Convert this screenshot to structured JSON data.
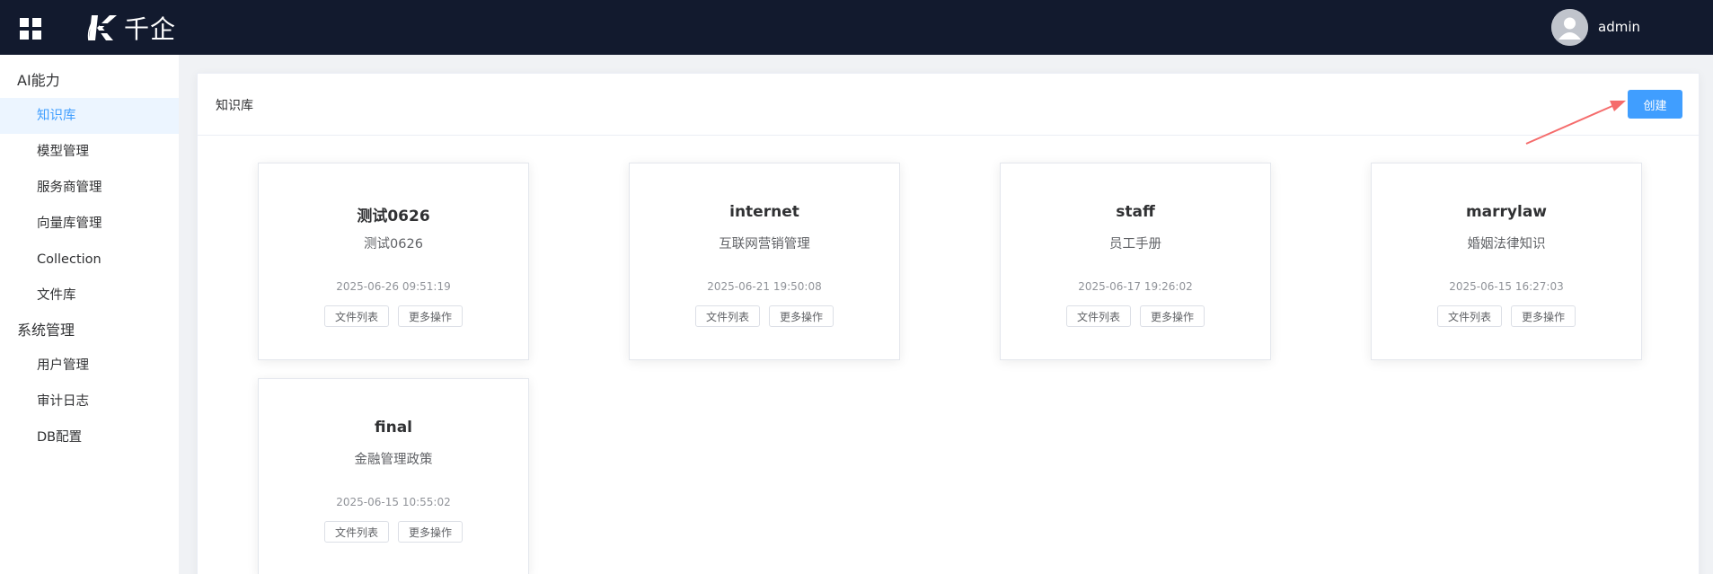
{
  "header": {
    "logo_text": "千企",
    "username": "admin"
  },
  "sidebar": {
    "groups": [
      {
        "label": "AI能力",
        "items": [
          {
            "label": "知识库",
            "active": true
          },
          {
            "label": "模型管理"
          },
          {
            "label": "服务商管理"
          },
          {
            "label": "向量库管理"
          },
          {
            "label": "Collection"
          },
          {
            "label": "文件库"
          }
        ]
      },
      {
        "label": "系统管理",
        "items": [
          {
            "label": "用户管理"
          },
          {
            "label": "审计日志"
          },
          {
            "label": "DB配置"
          }
        ]
      }
    ]
  },
  "main": {
    "title": "知识库",
    "create_label": "创建",
    "file_list_label": "文件列表",
    "more_actions_label": "更多操作",
    "cards": [
      {
        "title": "测试0626",
        "description": "测试0626",
        "time": "2025-06-26 09:51:19"
      },
      {
        "title": "internet",
        "description": "互联网营销管理",
        "time": "2025-06-21 19:50:08"
      },
      {
        "title": "staff",
        "description": "员工手册",
        "time": "2025-06-17 19:26:02"
      },
      {
        "title": "marrylaw",
        "description": "婚姻法律知识",
        "time": "2025-06-15 16:27:03"
      },
      {
        "title": "final",
        "description": "金融管理政策",
        "time": "2025-06-15 10:55:02"
      }
    ]
  },
  "colors": {
    "header_bg": "#121a2e",
    "accent": "#409eff",
    "active_menu_bg": "#ecf5ff",
    "annotation_arrow": "#f56c6c"
  }
}
